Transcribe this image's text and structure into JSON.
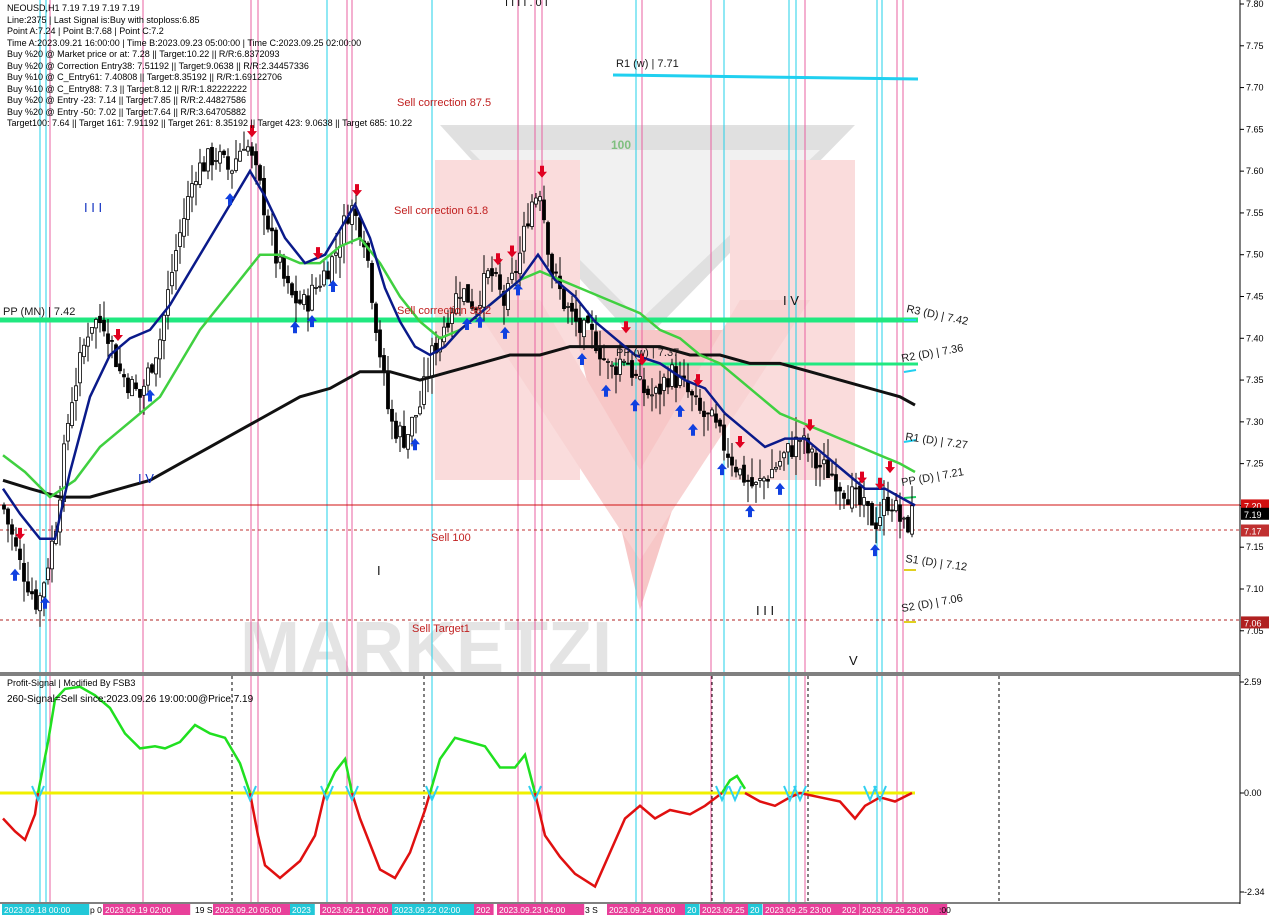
{
  "header": {
    "symbol_line": "NEOUSD,H1  7.19 7.19 7.19 7.19",
    "info_lines": [
      "Line:2375  | Last Signal is:Buy with stoploss:6.85",
      "Point A:7.24  | Point B:7.68  | Point C:7.2",
      "Time A:2023.09.21 16:00:00  | Time B:2023.09.23 05:00:00  | Time C:2023.09.25 02:00:00",
      "Buy %20 @ Market price or at: 7.28  || Target:10.22  || R/R:6.8372093",
      "Buy %20 @ Correction Entry38: 7.51192  || Target:9.0638  || R/R:2.34457336",
      "Buy %10 @ C_Entry61: 7.40808  || Target:8.35192  || R/R:1.69122706",
      "Buy %10 @ C_Entry88: 7.3  || Target:8.12  || R/R:1.82222222",
      "Buy %20 @ Entry -23: 7.14  || Target:7.85  || R/R:2.44827586",
      "Buy %20 @ Entry -50: 7.02  || Target:7.64  || R/R:3.64705882",
      "Target100: 7.64  || Target 161: 7.91192  || Target 261: 8.35192  || Target 423: 9.0638  || Target 685: 10.22"
    ]
  },
  "chart_labels": {
    "pp_mn": "PP (MN) | 7.42",
    "r1_w": "R1 (w) | 7.71",
    "pp_w": "PP (w) | 7.37",
    "r3_d": "R3 (D) | 7.42",
    "r2_d": "R2 (D) | 7.36",
    "r1_d": "R1 (D) | 7.27",
    "pp_d": "PP (D) | 7.21",
    "s1_d": "S1 (D) | 7.12",
    "s2_d": "S2 (D) | 7.06",
    "sell_corr_875": "Sell correction 87.5",
    "sell_corr_618": "Sell correction 61.8",
    "sell_corr_382": "Sell correction 38.2",
    "sell_100": "Sell 100",
    "sell_target1": "Sell Target1",
    "level_100": "100",
    "wave_iii_top": "I I I",
    "wave_iv_left": "I V",
    "wave_iv_right": "I V",
    "wave_iii_right": "I I I",
    "wave_v": "V",
    "wave_i": "I",
    "top_partial": "I I I  I . 0 I"
  },
  "price_axis": {
    "ticks": [
      "7.80",
      "7.75",
      "7.70",
      "7.65",
      "7.60",
      "7.55",
      "7.50",
      "7.45",
      "7.40",
      "7.35",
      "7.30",
      "7.25",
      "7.20",
      "7.15",
      "7.10",
      "7.05"
    ],
    "badges": [
      {
        "text": "7.20",
        "color": "#d01010"
      },
      {
        "text": "7.19",
        "color": "#000000"
      },
      {
        "text": "7.17",
        "color": "#c03030"
      },
      {
        "text": "7.06",
        "color": "#b02020"
      }
    ]
  },
  "indicator": {
    "title": "Profit-Signal | Modified By FSB3",
    "subtitle": "260-Signal=Sell since:2023.09.26 19:00:00@Price:7.19",
    "axis_ticks": [
      "2.59",
      "0.00",
      "-2.34"
    ]
  },
  "time_axis": [
    {
      "text": "2023.09.18 00:00",
      "bg": "#22c8d8"
    },
    {
      "text": "p 0",
      "bg": "#ffffff"
    },
    {
      "text": "2023.09.19 02:00",
      "bg": "#e8409a"
    },
    {
      "text": "19 S",
      "bg": "#ffffff"
    },
    {
      "text": "2023.09.20 05:00",
      "bg": "#e8409a"
    },
    {
      "text": "2023",
      "bg": "#22c8d8"
    },
    {
      "text": "2023.09.21 07:00",
      "bg": "#e8409a"
    },
    {
      "text": "2023.09.22 02:00",
      "bg": "#22c8d8"
    },
    {
      "text": "202",
      "bg": "#e8409a"
    },
    {
      "text": "2023.09.23 04:00",
      "bg": "#e8409a"
    },
    {
      "text": "3 S",
      "bg": "#ffffff"
    },
    {
      "text": "2023.09.24 08:00",
      "bg": "#e8409a"
    },
    {
      "text": "20",
      "bg": "#22c8d8"
    },
    {
      "text": "2023.09.25",
      "bg": "#e8409a"
    },
    {
      "text": "20",
      "bg": "#22c8d8"
    },
    {
      "text": "2023.09.25 23:00",
      "bg": "#e8409a"
    },
    {
      "text": "202",
      "bg": "#e8409a"
    },
    {
      "text": "2023.09.26 23:00",
      "bg": "#e8409a"
    },
    {
      "text": ":00",
      "bg": "#ffffff"
    }
  ],
  "watermark": "MARKETZI",
  "colors": {
    "bull_arrow": "#1040e0",
    "bear_arrow": "#e00020",
    "ma_fast": "#0a1a8a",
    "ma_mid": "#40d040",
    "ma_slow": "#111111",
    "pivot": "#20e880",
    "r1w": "#20d0f0",
    "cyan_vline": "#22d0e8",
    "pink_vline": "#e860a0"
  }
}
